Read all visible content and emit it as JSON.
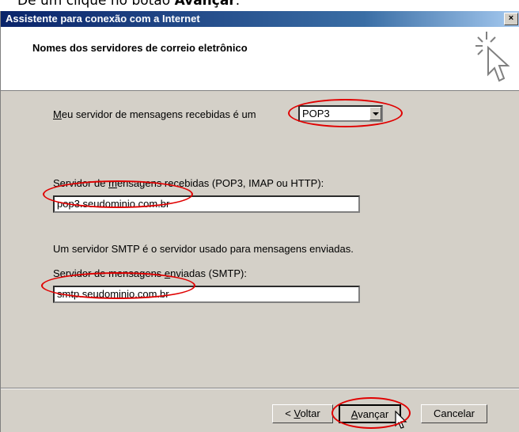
{
  "caption": {
    "prefix": "Dê um clique no botão ",
    "bold": "Avançar",
    "suffix": "."
  },
  "window": {
    "title": "Assistente para conexão com a Internet",
    "close_label": "×"
  },
  "header": {
    "title": "Nomes dos servidores de correio eletrônico"
  },
  "incoming_type": {
    "label_first": "M",
    "label_rest": "eu servidor de mensagens recebidas é um",
    "selected": "POP3"
  },
  "incoming_server": {
    "label_start": "Servidor de ",
    "label_u": "m",
    "label_end": "ensagens recebidas (POP3, IMAP ou HTTP):",
    "value": "pop3.seudominio.com.br"
  },
  "smtp_info": "Um servidor SMTP é o servidor usado para mensagens enviadas.",
  "outgoing_server": {
    "label_start": "Servidor de mensagens ",
    "label_u": "e",
    "label_end": "nviadas (SMTP):",
    "value": "smtp.seudominio.com.br"
  },
  "buttons": {
    "back_prefix": "< ",
    "back_u": "V",
    "back_rest": "oltar",
    "next_u": "A",
    "next_rest": "vançar",
    "cancel": "Cancelar"
  },
  "colors": {
    "highlight": "#e00000",
    "titlebar": "#0a246a"
  }
}
